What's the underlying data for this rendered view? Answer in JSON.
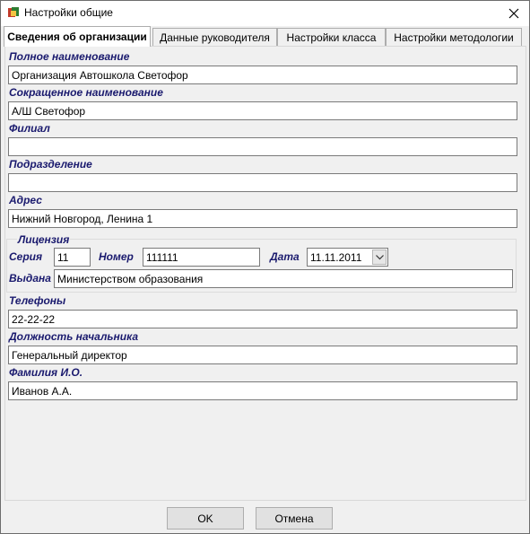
{
  "window": {
    "title": "Настройки общие"
  },
  "tabs": [
    {
      "label": "Сведения об организации",
      "active": true
    },
    {
      "label": "Данные руководителя",
      "active": false
    },
    {
      "label": "Настройки класса",
      "active": false
    },
    {
      "label": "Настройки методологии",
      "active": false
    }
  ],
  "form": {
    "full_name_label": "Полное наименование",
    "full_name_value": "Организация Автошкола Светофор",
    "short_name_label": "Сокращенное наименование",
    "short_name_value": "А/Ш Светофор",
    "branch_label": "Филиал",
    "branch_value": "",
    "division_label": "Подразделение",
    "division_value": "",
    "address_label": "Адрес",
    "address_value": "Нижний Новгород, Ленина 1",
    "license": {
      "group_label": "Лицензия",
      "series_label": "Серия",
      "series_value": "11",
      "number_label": "Номер",
      "number_value": "111111",
      "date_label": "Дата",
      "date_value": "11.11.2011",
      "issued_label": "Выдана",
      "issued_value": "Министерством образования"
    },
    "phones_label": "Телефоны",
    "phones_value": "22-22-22",
    "position_label": "Должность начальника",
    "position_value": "Генеральный директор",
    "fio_label": "Фамилия И.О.",
    "fio_value": "Иванов А.А."
  },
  "buttons": {
    "ok": "OK",
    "cancel": "Отмена"
  },
  "colors": {
    "label": "#1a1a6e",
    "window_bg": "#f0f0f0"
  },
  "icons": {
    "app": "app-icon",
    "close": "close-icon",
    "date_dropdown": "chevron-down-icon"
  }
}
